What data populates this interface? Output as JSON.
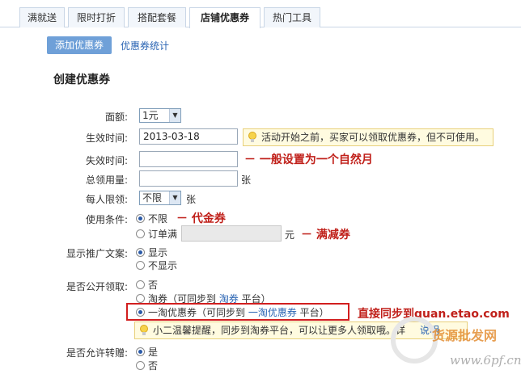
{
  "tabs": [
    "满就送",
    "限时打折",
    "搭配套餐",
    "店铺优惠券",
    "热门工具"
  ],
  "active_tab": "店铺优惠券",
  "subnav": {
    "active": "添加优惠券",
    "link": "优惠券统计"
  },
  "section_title": "创建优惠券",
  "form": {
    "face_value": {
      "label": "面额:",
      "value": "1元"
    },
    "start_time": {
      "label": "生效时间:",
      "value": "2013-03-18",
      "tip": "活动开始之前，买家可以领取优惠券，但不可使用。"
    },
    "end_time": {
      "label": "失效时间:",
      "value": ""
    },
    "total": {
      "label": "总领用量:",
      "value": "",
      "unit": "张"
    },
    "per_person": {
      "label": "每人限领:",
      "value": "不限",
      "unit": "张"
    },
    "condition": {
      "label": "使用条件:",
      "opt1": "不限",
      "opt2_prefix": "订单满",
      "opt2_unit": "元"
    },
    "promo_text": {
      "label": "显示推广文案:",
      "opt1": "显示",
      "opt2": "不显示"
    },
    "public": {
      "label": "是否公开领取:",
      "opt1": "否",
      "opt2_pre": "淘券（可同步到 ",
      "opt2_link": "淘券",
      "opt2_post": " 平台）",
      "opt3_pre": "一淘优惠券（可同步到 ",
      "opt3_link": "一淘优惠券",
      "opt3_post": " 平台）",
      "tip": "小二温馨提醒，同步到淘券平台，可以让更多人领取哦。详",
      "tip_link": "说明"
    },
    "transfer": {
      "label": "是否允许转赠:",
      "opt1": "是",
      "opt2": "否"
    }
  },
  "annotations": {
    "end_time": "－ 一般设置为一个自然月",
    "no_limit": "－ 代金券",
    "order_min": "－ 满减券",
    "sync": "直接同步到quan.etao.com"
  },
  "watermark": {
    "text": "货源批发网",
    "url": "www.6pf.cn"
  },
  "colors": {
    "annotation": "#c0201a",
    "link": "#2a64b3",
    "subnav_active": "#6fa0d8"
  }
}
